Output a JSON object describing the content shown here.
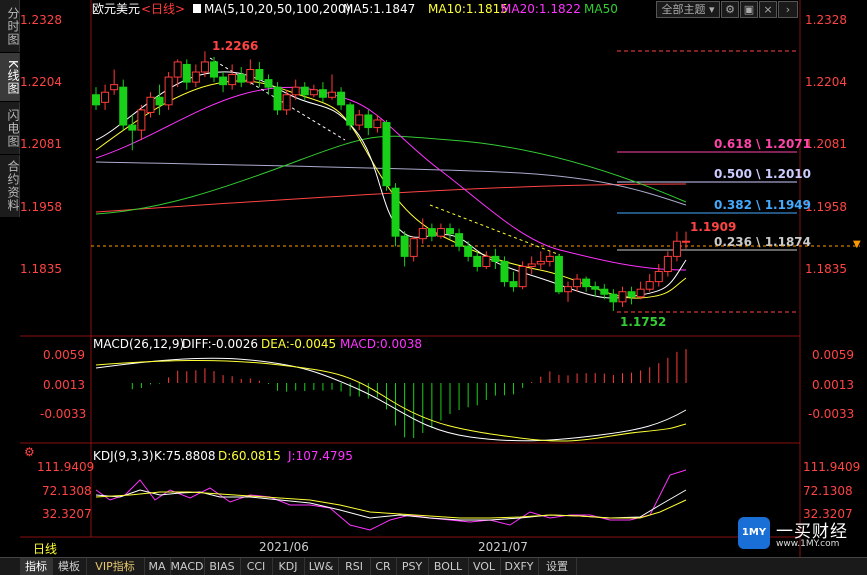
{
  "side_tabs": [
    {
      "label": "分时图",
      "active": false
    },
    {
      "label": "K线图",
      "active": true
    },
    {
      "label": "闪电图",
      "active": false
    },
    {
      "label": "合约资料",
      "active": false
    }
  ],
  "top_buttons": {
    "main_theme": "全部主题",
    "dropdown": "▾"
  },
  "header": {
    "symbol": "欧元美元",
    "period": "<日线>",
    "ma_title": "MA(5,10,20,50,100,200)",
    "ma5": "MA5:1.1847",
    "ma10": "MA10:1.1815",
    "ma20": "MA20:1.1822",
    "ma50": "MA50"
  },
  "colors": {
    "up": "#ff3b3b",
    "down": "#18d018",
    "ma5": "#ffffff",
    "ma10": "#ffff33",
    "ma20": "#ff33ff",
    "ma50": "#33cc33",
    "ma100": "#aaaacc",
    "ma200": "#ff4444",
    "price_label": "#ff4444",
    "grid": "#881111"
  },
  "price_axis": [
    "1.2328",
    "1.2204",
    "1.2081",
    "1.1958",
    "1.1835"
  ],
  "annotations": {
    "high": "1.2266",
    "low": "1.1752",
    "last_high": "1.1909"
  },
  "fib_levels": [
    {
      "label": "0.618 \\ 1.2071",
      "color": "#ff44aa"
    },
    {
      "label": "0.500 \\ 1.2010",
      "color": "#ccccff"
    },
    {
      "label": "0.382 \\ 1.1949",
      "color": "#44aaff"
    },
    {
      "label": "0.236 \\ 1.1874",
      "color": "#cccccc"
    }
  ],
  "macd": {
    "title": "MACD(26,12,9)",
    "diff": "DIFF:-0.0026",
    "dea": "DEA:-0.0045",
    "macd": "MACD:0.0038",
    "axis": [
      "0.0059",
      "0.0013",
      "-0.0033"
    ]
  },
  "kdj": {
    "title": "KDJ(9,3,3)",
    "k": "K:75.8808",
    "d": "D:60.0815",
    "j": "J:107.4795",
    "axis": [
      "111.9409",
      "72.1308",
      "32.3207"
    ]
  },
  "x_axis": {
    "period_label": "日线",
    "dates": [
      "2021/06",
      "2021/07"
    ]
  },
  "bottom_tabs": [
    {
      "label": "指标",
      "active": true,
      "vip": false
    },
    {
      "label": "模板",
      "active": false,
      "vip": false
    },
    {
      "label": "VIP指标",
      "active": false,
      "vip": true
    },
    {
      "label": "MA",
      "active": false,
      "vip": false
    },
    {
      "label": "MACD",
      "active": false,
      "vip": false
    },
    {
      "label": "BIAS",
      "active": false,
      "vip": false
    },
    {
      "label": "CCI",
      "active": false,
      "vip": false
    },
    {
      "label": "KDJ",
      "active": false,
      "vip": false
    },
    {
      "label": "LW&",
      "active": false,
      "vip": false
    },
    {
      "label": "RSI",
      "active": false,
      "vip": false
    },
    {
      "label": "CR",
      "active": false,
      "vip": false
    },
    {
      "label": "PSY",
      "active": false,
      "vip": false
    },
    {
      "label": "BOLL",
      "active": false,
      "vip": false
    },
    {
      "label": "VOL",
      "active": false,
      "vip": false
    },
    {
      "label": "DXFY",
      "active": false,
      "vip": false
    },
    {
      "label": "设置",
      "active": false,
      "vip": false
    }
  ],
  "logo": {
    "badge": "1MY",
    "name": "一买财经",
    "url": "www.1MY.com"
  },
  "candles": [
    [
      1.218,
      1.216,
      1.2195,
      1.215
    ],
    [
      1.2165,
      1.2185,
      1.22,
      1.215
    ],
    [
      1.219,
      1.22,
      1.223,
      1.218
    ],
    [
      1.2195,
      1.212,
      1.221,
      1.211
    ],
    [
      1.212,
      1.211,
      1.214,
      1.207
    ],
    [
      1.211,
      1.215,
      1.216,
      1.209
    ],
    [
      1.2145,
      1.2175,
      1.2185,
      1.2135
    ],
    [
      1.2175,
      1.216,
      1.22,
      1.214
    ],
    [
      1.216,
      1.2215,
      1.2225,
      1.215
    ],
    [
      1.2215,
      1.2245,
      1.225,
      1.2195
    ],
    [
      1.224,
      1.2205,
      1.225,
      1.219
    ],
    [
      1.2205,
      1.2225,
      1.224,
      1.2195
    ],
    [
      1.2225,
      1.2245,
      1.2266,
      1.2215
    ],
    [
      1.2245,
      1.2215,
      1.2255,
      1.2205
    ],
    [
      1.2215,
      1.22,
      1.2225,
      1.2185
    ],
    [
      1.22,
      1.222,
      1.224,
      1.219
    ],
    [
      1.222,
      1.2205,
      1.2235,
      1.2195
    ],
    [
      1.2205,
      1.223,
      1.225,
      1.22
    ],
    [
      1.223,
      1.221,
      1.2245,
      1.2195
    ],
    [
      1.221,
      1.2195,
      1.222,
      1.218
    ],
    [
      1.2195,
      1.215,
      1.2205,
      1.214
    ],
    [
      1.215,
      1.218,
      1.219,
      1.214
    ],
    [
      1.218,
      1.2195,
      1.221,
      1.217
    ],
    [
      1.2195,
      1.218,
      1.2205,
      1.217
    ],
    [
      1.218,
      1.219,
      1.22,
      1.2175
    ],
    [
      1.219,
      1.2175,
      1.2205,
      1.2165
    ],
    [
      1.2175,
      1.2185,
      1.222,
      1.217
    ],
    [
      1.2185,
      1.216,
      1.2195,
      1.215
    ],
    [
      1.216,
      1.212,
      1.2165,
      1.211
    ],
    [
      1.212,
      1.214,
      1.215,
      1.211
    ],
    [
      1.214,
      1.2115,
      1.215,
      1.21
    ],
    [
      1.2115,
      1.213,
      1.214,
      1.2105
    ],
    [
      1.2125,
      1.2,
      1.213,
      1.199
    ],
    [
      1.1995,
      1.19,
      1.2005,
      1.188
    ],
    [
      1.19,
      1.186,
      1.191,
      1.184
    ],
    [
      1.186,
      1.1895,
      1.19,
      1.185
    ],
    [
      1.1895,
      1.1915,
      1.1935,
      1.1885
    ],
    [
      1.1915,
      1.19,
      1.1925,
      1.189
    ],
    [
      1.19,
      1.1915,
      1.1925,
      1.1895
    ],
    [
      1.1915,
      1.1905,
      1.1925,
      1.1895
    ],
    [
      1.1905,
      1.188,
      1.1915,
      1.187
    ],
    [
      1.188,
      1.186,
      1.189,
      1.185
    ],
    [
      1.186,
      1.184,
      1.187,
      1.183
    ],
    [
      1.184,
      1.186,
      1.187,
      1.1835
    ],
    [
      1.186,
      1.185,
      1.1875,
      1.1835
    ],
    [
      1.185,
      1.181,
      1.186,
      1.18
    ],
    [
      1.181,
      1.18,
      1.183,
      1.179
    ],
    [
      1.18,
      1.184,
      1.185,
      1.1795
    ],
    [
      1.184,
      1.1845,
      1.186,
      1.1825
    ],
    [
      1.1845,
      1.185,
      1.187,
      1.1835
    ],
    [
      1.185,
      1.186,
      1.187,
      1.184
    ],
    [
      1.186,
      1.179,
      1.1865,
      1.1785
    ],
    [
      1.179,
      1.18,
      1.181,
      1.177
    ],
    [
      1.18,
      1.1815,
      1.1825,
      1.179
    ],
    [
      1.1815,
      1.18,
      1.182,
      1.179
    ],
    [
      1.18,
      1.1795,
      1.181,
      1.178
    ],
    [
      1.1795,
      1.1785,
      1.1805,
      1.1775
    ],
    [
      1.1785,
      1.177,
      1.1795,
      1.1752
    ],
    [
      1.177,
      1.179,
      1.18,
      1.176
    ],
    [
      1.179,
      1.178,
      1.18,
      1.1765
    ],
    [
      1.178,
      1.1795,
      1.181,
      1.1775
    ],
    [
      1.1795,
      1.181,
      1.1825,
      1.179
    ],
    [
      1.181,
      1.183,
      1.1845,
      1.18
    ],
    [
      1.183,
      1.186,
      1.187,
      1.182
    ],
    [
      1.186,
      1.189,
      1.1909,
      1.185
    ],
    [
      1.189,
      1.189,
      1.1909,
      1.1875
    ]
  ]
}
